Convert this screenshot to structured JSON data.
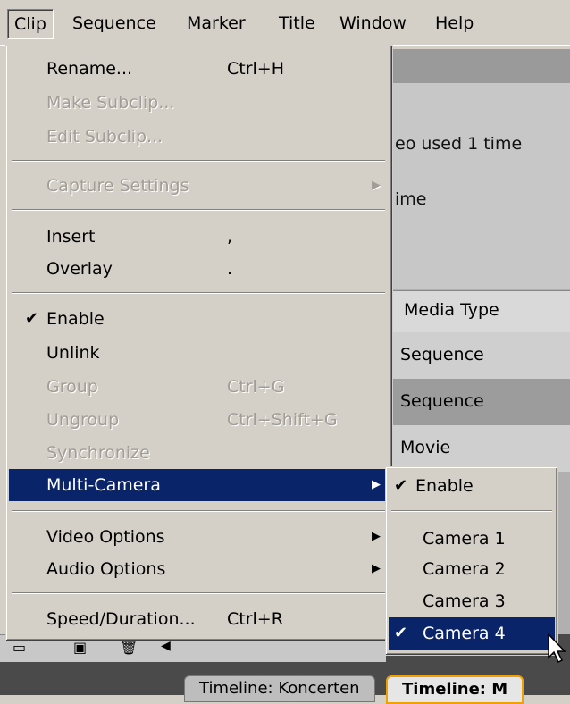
{
  "menubar": {
    "items": [
      "Clip",
      "Sequence",
      "Marker",
      "Title",
      "Window",
      "Help"
    ]
  },
  "background": {
    "info_line1": "eo used 1 time",
    "info_line2": "ime",
    "column_header": "Media Type",
    "rows": [
      "Sequence",
      "Sequence",
      "Movie"
    ],
    "tabs": [
      "Timeline: Koncerten",
      "Timeline: M"
    ]
  },
  "clip_menu": {
    "rename": {
      "label": "Rename...",
      "shortcut": "Ctrl+H"
    },
    "make_subclip": {
      "label": "Make Subclip..."
    },
    "edit_subclip": {
      "label": "Edit Subclip..."
    },
    "capture_settings": {
      "label": "Capture Settings"
    },
    "insert": {
      "label": "Insert",
      "shortcut": ","
    },
    "overlay": {
      "label": "Overlay",
      "shortcut": "."
    },
    "enable": {
      "label": "Enable",
      "checked": true
    },
    "unlink": {
      "label": "Unlink"
    },
    "group": {
      "label": "Group",
      "shortcut": "Ctrl+G"
    },
    "ungroup": {
      "label": "Ungroup",
      "shortcut": "Ctrl+Shift+G"
    },
    "synchronize": {
      "label": "Synchronize"
    },
    "multi_camera": {
      "label": "Multi-Camera"
    },
    "video_options": {
      "label": "Video Options"
    },
    "audio_options": {
      "label": "Audio Options"
    },
    "speed_duration": {
      "label": "Speed/Duration...",
      "shortcut": "Ctrl+R"
    }
  },
  "multicam_menu": {
    "enable": {
      "label": "Enable",
      "checked": true
    },
    "camera1": {
      "label": "Camera 1"
    },
    "camera2": {
      "label": "Camera 2"
    },
    "camera3": {
      "label": "Camera 3"
    },
    "camera4": {
      "label": "Camera 4",
      "checked": true
    }
  },
  "colors": {
    "highlight": "#0a246a",
    "menu_bg": "#d4d0c8",
    "disabled_text": "#a29e96"
  }
}
